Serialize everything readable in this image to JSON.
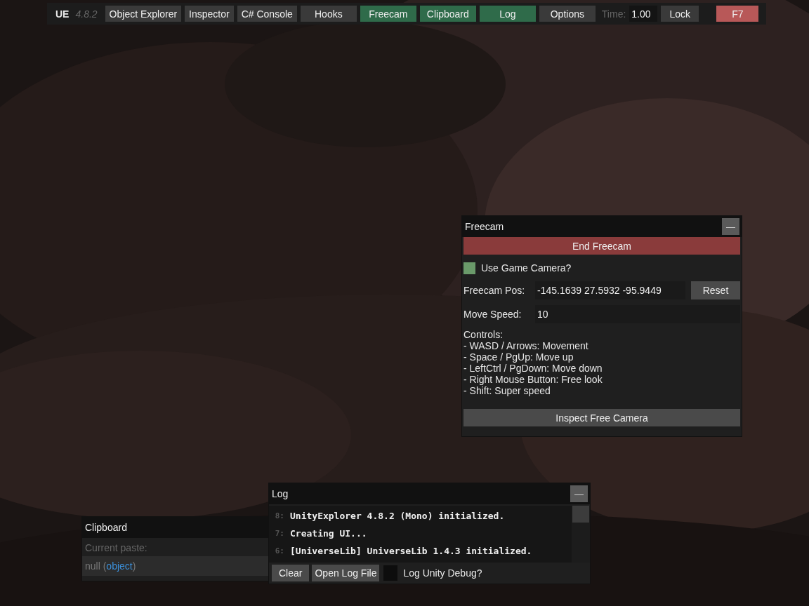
{
  "navbar": {
    "brand": "UE",
    "version": "4.8.2",
    "buttons": [
      {
        "label": "Object Explorer",
        "selected": false
      },
      {
        "label": "Inspector",
        "selected": false
      },
      {
        "label": "C# Console",
        "selected": false
      },
      {
        "label": "Hooks",
        "selected": false
      },
      {
        "label": "Freecam",
        "selected": true
      },
      {
        "label": "Clipboard",
        "selected": true
      },
      {
        "label": "Log",
        "selected": true
      },
      {
        "label": "Options",
        "selected": false
      }
    ],
    "time_label": "Time:",
    "time_value": "1.00",
    "lock_button": "Lock",
    "close_button": "F7"
  },
  "freecam": {
    "title": "Freecam",
    "minimize": "—",
    "end_button": "End Freecam",
    "use_game_camera": {
      "label": "Use Game Camera?",
      "checked": true
    },
    "position": {
      "label": "Freecam Pos:",
      "value": "-145.1639 27.5932 -95.9449",
      "reset": "Reset"
    },
    "speed": {
      "label": "Move Speed:",
      "value": "10"
    },
    "controls": [
      "Controls:",
      "- WASD / Arrows: Movement",
      "- Space / PgUp: Move up",
      "- LeftCtrl / PgDown: Move down",
      "- Right Mouse Button: Free look",
      "- Shift: Super speed"
    ],
    "inspect_button": "Inspect Free Camera"
  },
  "clipboard": {
    "title": "Clipboard",
    "label": "Current paste:",
    "value": [
      {
        "kind": "plain",
        "text": "null ("
      },
      {
        "kind": "type",
        "text": "object"
      },
      {
        "kind": "plain",
        "text": ")"
      }
    ]
  },
  "log": {
    "title": "Log",
    "minimize": "—",
    "lines": [
      {
        "number": "8:",
        "text": "UnityExplorer 4.8.2 (Mono) initialized."
      },
      {
        "number": "7:",
        "text": "Creating UI..."
      },
      {
        "number": "6:",
        "text": "[UniverseLib] UniverseLib 1.4.3 initialized."
      }
    ],
    "clear": "Clear",
    "open_file": "Open Log File",
    "unity_debug": {
      "label": "Log Unity Debug?",
      "checked": false
    }
  }
}
